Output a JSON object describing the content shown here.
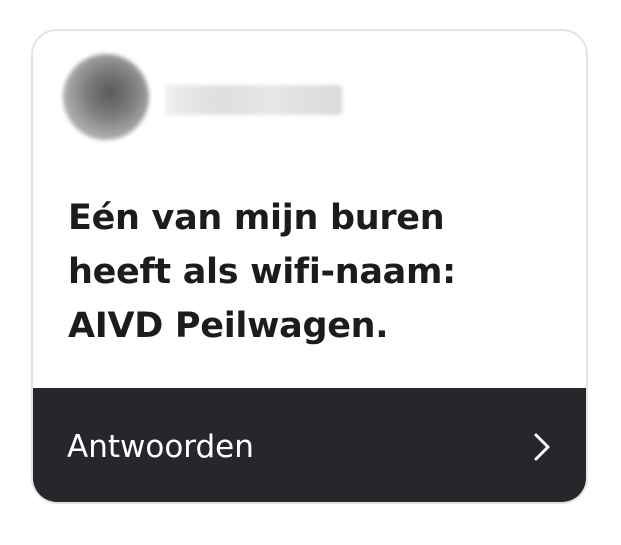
{
  "post": {
    "message_lines": [
      "Eén van mijn buren",
      "heeft als wifi-naam:",
      "AIVD Peilwagen."
    ]
  },
  "footer": {
    "reply_label": "Antwoorden",
    "chevron_icon": "chevron-right-icon"
  },
  "colors": {
    "footer_background": "#25272b",
    "text_primary": "#1c1c1e",
    "card_border": "#e4e4e6"
  }
}
